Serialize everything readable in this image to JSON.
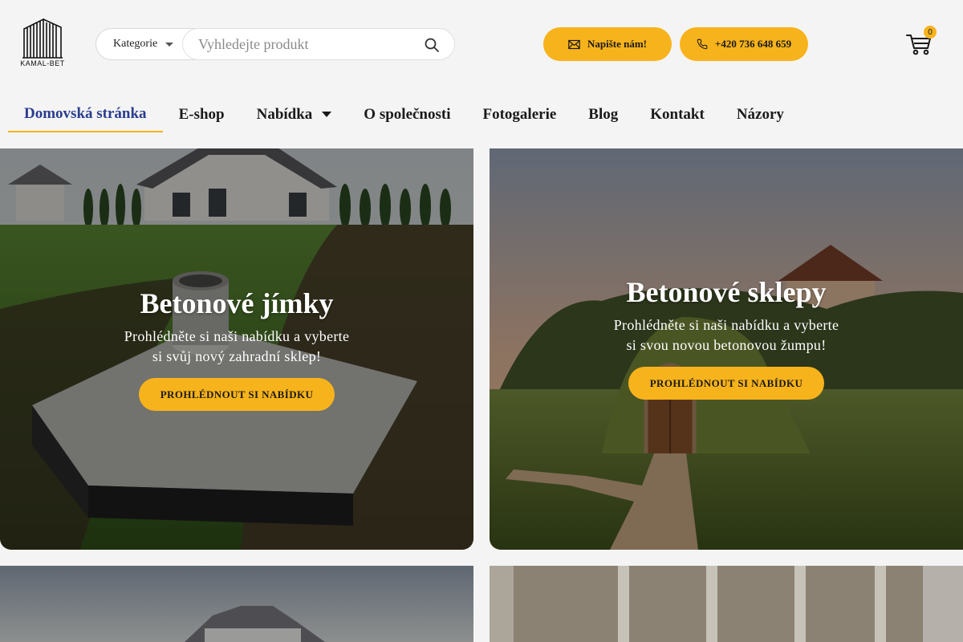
{
  "header": {
    "logo_text": "KAMAL-BET",
    "category_label": "Kategorie",
    "search_placeholder": "Vyhledejte produkt",
    "contact_button_label": "Napište nám!",
    "phone_button_label": "+420 736 648 659",
    "cart_count": "0"
  },
  "nav": {
    "items": [
      {
        "label": "Domovská stránka"
      },
      {
        "label": "E-shop"
      },
      {
        "label": "Nabídka"
      },
      {
        "label": "O společnosti"
      },
      {
        "label": "Fotogalerie"
      },
      {
        "label": "Blog"
      },
      {
        "label": "Kontakt"
      },
      {
        "label": "Názory"
      }
    ]
  },
  "cards": [
    {
      "title": "Betonové jímky",
      "text": "Prohlédněte si naši nabídku a vyberte si svůj nový zahradní sklep!",
      "button": "PROHLÉDNOUT SI NABÍDKU"
    },
    {
      "title": "Betonové sklepy",
      "text": "Prohlédněte si naši nabídku a vyberte si svou novou betonovou žumpu!",
      "button": "PROHLÉDNOUT SI NABÍDKU"
    }
  ],
  "colors": {
    "accent": "#f7b31b",
    "nav_active": "#2a3d8f",
    "header_bg": "#f4f4f4"
  }
}
